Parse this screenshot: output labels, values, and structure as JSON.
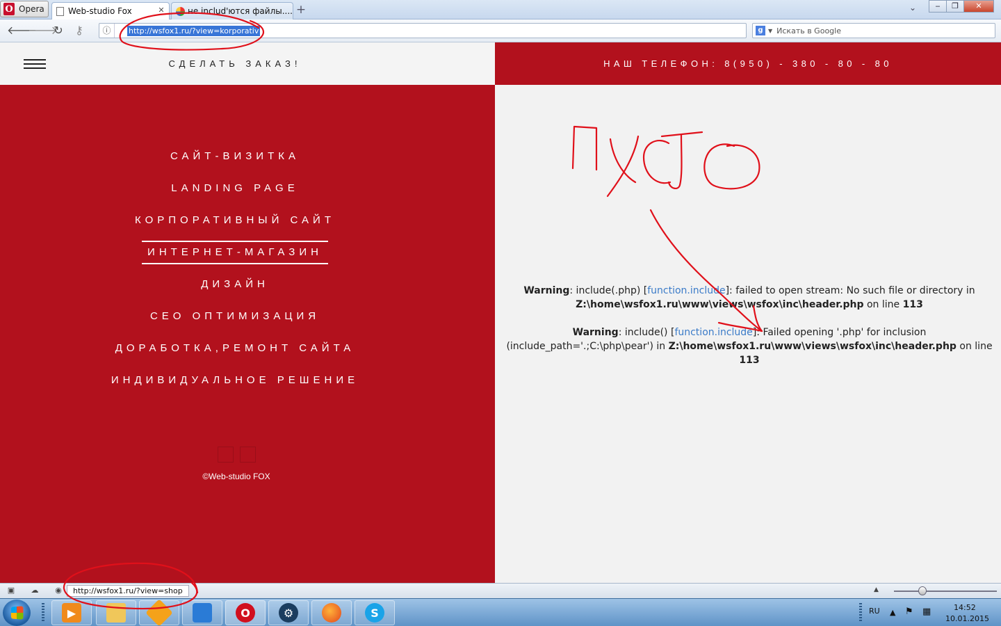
{
  "browser": {
    "app_label": "Opera",
    "tabs": [
      {
        "label": "Web-studio Fox",
        "active": true
      },
      {
        "label": "не includ'ются файлы....",
        "active": false
      }
    ],
    "address": "http://wsfox1.ru/?view=korporativ",
    "search_placeholder": "Искать в Google",
    "status_url": "http://wsfox1.ru/?view=shop"
  },
  "site": {
    "order_label": "СДЕЛАТЬ ЗАКАЗ!",
    "phone_label": "НАШ ТЕЛЕФОН: 8(950) - 380 - 80 - 80",
    "menu": [
      {
        "label": "САЙТ-ВИЗИТКА"
      },
      {
        "label": "LANDING PAGE"
      },
      {
        "label": "КОРПОРАТИВНЫЙ САЙТ"
      },
      {
        "label": "ИНТЕРНЕТ-МАГАЗИН",
        "active": true
      },
      {
        "label": "ДИЗАЙН"
      },
      {
        "label": "СЕО ОПТИМИЗАЦИЯ"
      },
      {
        "label": "ДОРАБОТКА,РЕМОНТ САЙТА"
      },
      {
        "label": "ИНДИВИДУАЛЬНОЕ РЕШЕНИЕ"
      }
    ],
    "copyright": "©Web-studio FOX"
  },
  "warnings": [
    {
      "label": "Warning",
      "pre": ": include(.php) [",
      "link": "function.include",
      "mid": "]: failed to open stream: No such file or directory in ",
      "path": "Z:\\home\\wsfox1.ru\\www\\views\\wsfox\\inc\\header.php",
      "on_line": " on line ",
      "line": "113"
    },
    {
      "label": "Warning",
      "pre": ": include() [",
      "link": "function.include",
      "mid": "]: Failed opening '.php' for inclusion (include_path='.;C:\\php\\pear') in ",
      "path": "Z:\\home\\wsfox1.ru\\www\\views\\wsfox\\inc\\header.php",
      "on_line": " on line ",
      "line": "113"
    }
  ],
  "annotation_text": "ПУСТО",
  "taskbar": {
    "language": "RU",
    "time": "14:52",
    "date": "10.01.2015"
  },
  "colors": {
    "brand_red": "#b2111d",
    "annotation_red": "#e0101a",
    "link_blue": "#3b7bc8"
  }
}
